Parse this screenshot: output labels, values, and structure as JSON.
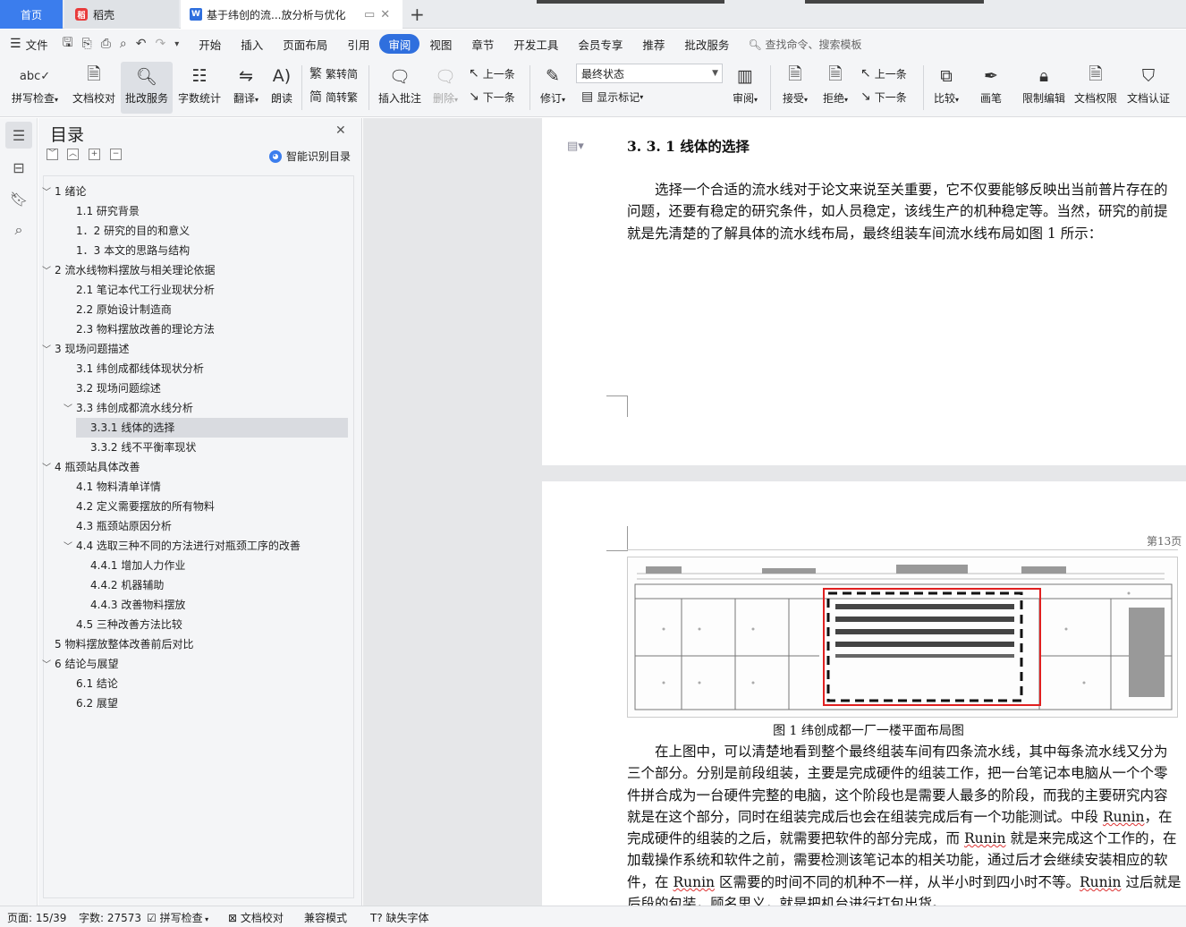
{
  "tabs": {
    "home": "首页",
    "daoke": "稻壳",
    "doc_title": "基于纬创的流...放分析与优化"
  },
  "menu": {
    "file": "文件",
    "items": [
      "开始",
      "插入",
      "页面布局",
      "引用",
      "审阅",
      "视图",
      "章节",
      "开发工具",
      "会员专享",
      "推荐",
      "批改服务"
    ],
    "active": "审阅",
    "search": "查找命令、搜索模板"
  },
  "ribbon": {
    "spell": "拼写检查",
    "proof": "文档校对",
    "grading": "批改服务",
    "wordcount": "字数统计",
    "translate": "翻译",
    "read": "朗读",
    "to_trad": "繁转简",
    "to_simp": "简转繁",
    "insert_comment": "插入批注",
    "delete": "删除",
    "prev": "上一条",
    "next": "下一条",
    "revise": "修订",
    "status_value": "最终状态",
    "show_marks": "显示标记",
    "review": "审阅",
    "accept": "接受",
    "reject": "拒绝",
    "prev2": "上一条",
    "next2": "下一条",
    "compare": "比较",
    "pen": "画笔",
    "restrict": "限制编辑",
    "rights": "文档权限",
    "certify": "文档认证"
  },
  "toc": {
    "title": "目录",
    "smart": "智能识别目录",
    "items": [
      {
        "text": "1  绪论",
        "level": 1,
        "chevron": "﹀"
      },
      {
        "text": "1.1 研究背景",
        "level": 2
      },
      {
        "text": "1．2 研究的目的和意义",
        "level": 2
      },
      {
        "text": "1．3 本文的思路与结构",
        "level": 2
      },
      {
        "text": "2  流水线物料摆放与相关理论依据",
        "level": 1,
        "chevron": "﹀"
      },
      {
        "text": "2.1 笔记本代工行业现状分析",
        "level": 2
      },
      {
        "text": "2.2 原始设计制造商",
        "level": 2
      },
      {
        "text": "2.3 物料摆放改善的理论方法",
        "level": 2
      },
      {
        "text": "3 现场问题描述",
        "level": 1,
        "chevron": "﹀"
      },
      {
        "text": "3.1 纬创成都线体现状分析",
        "level": 2
      },
      {
        "text": "3.2 现场问题综述",
        "level": 2
      },
      {
        "text": "3.3 纬创成都流水线分析",
        "level": 2,
        "chevron": "﹀"
      },
      {
        "text": "3.3.1 线体的选择",
        "level": 3,
        "selected": true
      },
      {
        "text": "3.3.2 线不平衡率现状",
        "level": 3
      },
      {
        "text": "4 瓶颈站具体改善",
        "level": 1,
        "chevron": "﹀"
      },
      {
        "text": "4.1 物料清单详情",
        "level": 2
      },
      {
        "text": "4.2 定义需要摆放的所有物料",
        "level": 2
      },
      {
        "text": "4.3 瓶颈站原因分析",
        "level": 2
      },
      {
        "text": "4.4 选取三种不同的方法进行对瓶颈工序的改善",
        "level": 2,
        "chevron": "﹀"
      },
      {
        "text": "4.4.1 增加人力作业",
        "level": 3
      },
      {
        "text": "4.4.2 机器辅助",
        "level": 3
      },
      {
        "text": "4.4.3 改善物料摆放",
        "level": 3
      },
      {
        "text": "4.5 三种改善方法比较",
        "level": 2
      },
      {
        "text": "5  物料摆放整体改善前后对比",
        "level": 1
      },
      {
        "text": "6  结论与展望",
        "level": 1,
        "chevron": "﹀"
      },
      {
        "text": "6.1 结论",
        "level": 2
      },
      {
        "text": "6.2 展望",
        "level": 2
      }
    ]
  },
  "document": {
    "heading": "3. 3. 1 线体的选择",
    "p1_lines": [
      "选择一个合适的流水线对于论文来说至关重要，它不仅要能够反映出当前普片存在的",
      "问题，还要有稳定的研究条件，如人员稳定，该线生产的机种稳定等。当然，研究的前提",
      "就是先清楚的了解具体的流水线布局，最终组装车间流水线布局如图 1 所示："
    ],
    "page_num": "第13页",
    "caption": "图 1    纬创成都一厂一楼平面布局图",
    "p2_lines": [
      "在上图中，可以清楚地看到整个最终组装车间有四条流水线，其中每条流水线又分为",
      "三个部分。分别是前段组装，主要是完成硬件的组装工作，把一台笔记本电脑从一个个零",
      "件拼合成为一台硬件完整的电脑，这个阶段也是需要人最多的阶段，而我的主要研究内容",
      "就是在这个部分，同时在组装完成后也会在组装完成后有一个功能测试。中段 Runin，在",
      "完成硬件的组装的之后，就需要把软件的部分完成，而 Runin 就是来完成这个工作的，在",
      "加载操作系统和软件之前，需要检测该笔记本的相关功能，通过后才会继续安装相应的软",
      "件，在 Runin 区需要的时间不同的机种不一样，从半小时到四小时不等。Runin 过后就是",
      "后段的包装，顾名思义，就是把机台进行打包出货。"
    ]
  },
  "status": {
    "page": "页面: 15/39",
    "words": "字数: 27573",
    "spell": "拼写检查",
    "proof": "文档校对",
    "compat": "兼容模式",
    "missing_font": "缺失字体"
  },
  "colors": {
    "accent": "#2f6fde",
    "home_tab": "#3b7ded",
    "highlight_box": "#e02020"
  }
}
